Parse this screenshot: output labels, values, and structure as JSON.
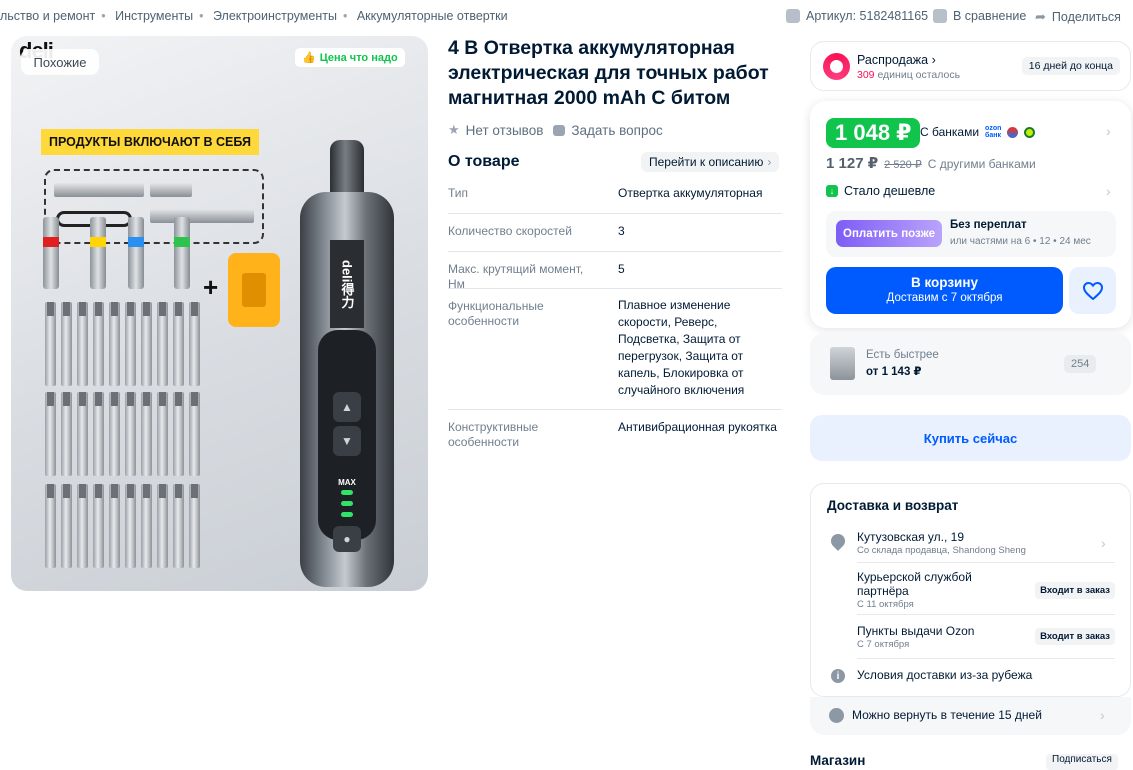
{
  "breadcrumbs": [
    "льство и ремонт",
    "Инструменты",
    "Электроинструменты",
    "Аккумуляторные отвертки"
  ],
  "top_meta": {
    "article": "Артикул: 5182481165",
    "compare": "В сравнение",
    "share": "Поделиться"
  },
  "gallery": {
    "similar": "Похожие",
    "price_good": "Цена что надо",
    "brand_corner": "deli",
    "includes_banner": "ПРОДУКТЫ ВКЛЮЧАЮТ В СЕБЯ",
    "driver_brand": "deli得力",
    "max_label": "MAX"
  },
  "product": {
    "title": "4 В Отвертка аккумуляторная электрическая для точных работ магнитная 2000 mAh С битом",
    "no_reviews": "Нет отзывов",
    "ask_question": "Задать вопрос"
  },
  "about": {
    "heading": "О товаре",
    "goto": "Перейти к описанию",
    "specs": [
      {
        "key": "Тип",
        "value": "Отвертка аккумуляторная"
      },
      {
        "key": "Количество скоростей",
        "value": "3"
      },
      {
        "key": "Макс. крутящий момент, Нм",
        "value": "5"
      },
      {
        "key": "Функциональные особенности",
        "value": "Плавное изменение скорости, Реверс, Подсветка, Защита от перегрузок, Защита от капель, Блокировка от случайного включения"
      },
      {
        "key": "Конструктивные особенности",
        "value": "Антивибрационная рукоятка"
      }
    ]
  },
  "sale": {
    "title": "Распродажа",
    "units_count": "309",
    "units_text": " единиц осталось",
    "days": "16 дней до конца"
  },
  "price": {
    "bank_price": "1 048 ₽",
    "with_banks": "С банками",
    "regular": "1 127 ₽",
    "old": "2 520 ₽",
    "other_banks": "С другими банками",
    "cheaper": "Стало дешевле",
    "split_button": "Оплатить позже",
    "split_title": "Без переплат",
    "split_sub": "или частями на 6 • 12 • 24 мес",
    "cart_label": "В корзину",
    "cart_sub": "Доставим с 7 октября"
  },
  "faster": {
    "label": "Есть быстрее",
    "price": "от 1 143 ₽",
    "count": "254"
  },
  "buy_now": "Купить сейчас",
  "delivery": {
    "heading": "Доставка и возврат",
    "address": "Кутузовская ул., 19",
    "address_sub": "Со склада продавца, Shandong Sheng",
    "courier": "Курьерской службой партнёра",
    "courier_date": "С 11 октября",
    "courier_badge": "Входит в заказ",
    "pickup": "Пункты выдачи Ozon",
    "pickup_date": "С 7 октября",
    "pickup_badge": "Входит в заказ",
    "abroad": "Условия доставки из-за рубежа",
    "return": "Можно вернуть в течение 15 дней"
  },
  "shop": {
    "heading": "Магазин",
    "subscribe": "Подписаться"
  },
  "colors": {
    "accent": "#005bff",
    "green": "#10c44c",
    "pink": "#f91155",
    "text": "#001a34"
  }
}
